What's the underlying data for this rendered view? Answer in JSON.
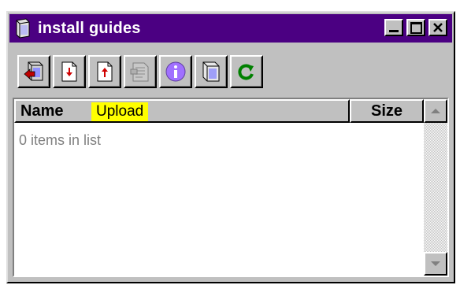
{
  "window": {
    "title": "install guides",
    "title_bar_color": "#4b0082",
    "buttons": [
      "minimize",
      "maximize",
      "close"
    ]
  },
  "toolbar": {
    "buttons": [
      {
        "name": "exit-icon"
      },
      {
        "name": "download-icon"
      },
      {
        "name": "upload-icon"
      },
      {
        "name": "document-icon",
        "disabled": true
      },
      {
        "name": "info-icon"
      },
      {
        "name": "book-icon"
      },
      {
        "name": "refresh-icon"
      }
    ]
  },
  "list": {
    "columns": {
      "name": "Name",
      "size": "Size"
    },
    "tooltip": "Upload",
    "empty_text": "0 items in list"
  }
}
